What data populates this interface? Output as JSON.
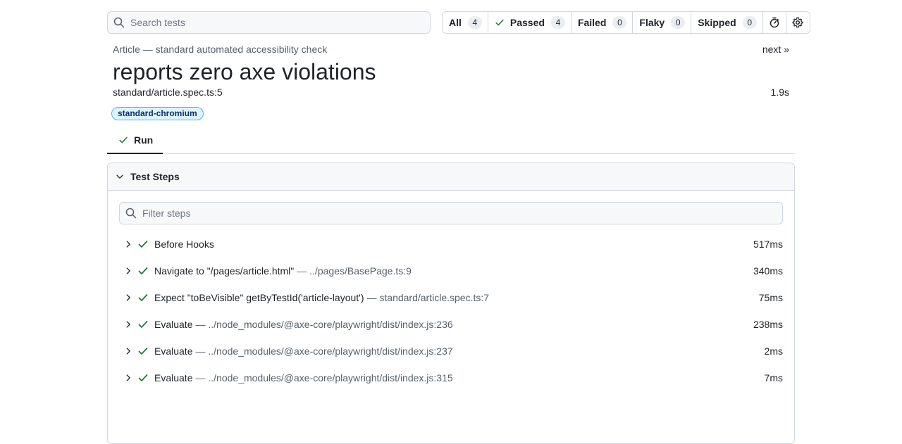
{
  "search": {
    "placeholder": "Search tests"
  },
  "filters": [
    {
      "label": "All",
      "count": "4"
    },
    {
      "label": "Passed",
      "count": "4"
    },
    {
      "label": "Failed",
      "count": "0"
    },
    {
      "label": "Flaky",
      "count": "0"
    },
    {
      "label": "Skipped",
      "count": "0"
    }
  ],
  "header": {
    "breadcrumb": "Article — standard automated accessibility check",
    "next": "next »",
    "title": "reports zero axe violations",
    "location": "standard/article.spec.ts:5",
    "duration": "1.9s",
    "project_badge": "standard-chromium"
  },
  "tabs": [
    {
      "label": "Run"
    }
  ],
  "steps_panel": {
    "title": "Test Steps",
    "filter_placeholder": "Filter steps",
    "steps": [
      {
        "name": "Before Hooks",
        "source": "",
        "time": "517ms"
      },
      {
        "name": "Navigate to \"/pages/article.html\"",
        "source": "— ../pages/BasePage.ts:9",
        "time": "340ms"
      },
      {
        "name": "Expect \"toBeVisible\" getByTestId('article-layout')",
        "source": "— standard/article.spec.ts:7",
        "time": "75ms"
      },
      {
        "name": "Evaluate",
        "source": "— ../node_modules/@axe-core/playwright/dist/index.js:236",
        "time": "238ms"
      },
      {
        "name": "Evaluate",
        "source": "— ../node_modules/@axe-core/playwright/dist/index.js:237",
        "time": "2ms"
      },
      {
        "name": "Evaluate",
        "source": "— ../node_modules/@axe-core/playwright/dist/index.js:315",
        "time": "7ms"
      }
    ]
  },
  "colors": {
    "pass": "#1a7f37",
    "badge_border": "#54aeff",
    "badge_bg": "#ddf4ff"
  }
}
